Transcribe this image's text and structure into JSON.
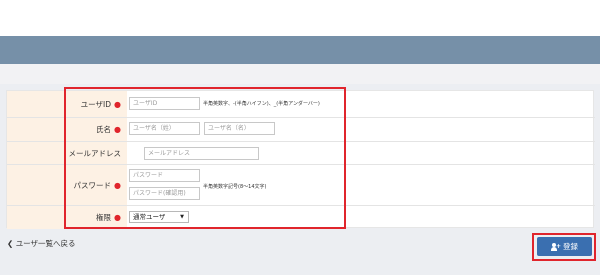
{
  "form": {
    "rows": {
      "userid": {
        "label": "ユーザID",
        "required": "●",
        "placeholder": "ユーザID",
        "hint": "半角英数字、-(半角ハイフン)、_(半角アンダーバー)"
      },
      "name": {
        "label": "氏名",
        "required": "●",
        "last_placeholder": "ユーザ名（姓）",
        "first_placeholder": "ユーザ名（名）"
      },
      "email": {
        "label": "メールアドレス",
        "placeholder": "メールアドレス"
      },
      "password": {
        "label": "パスワード",
        "required": "●",
        "placeholder": "パスワード",
        "confirm_placeholder": "パスワード(確認用)",
        "hint": "半角英数字記号(8〜14文字)"
      },
      "role": {
        "label": "権限",
        "required": "●",
        "selected": "通常ユーザ",
        "arrow": "▼"
      }
    }
  },
  "footer": {
    "back_chevron": "❮",
    "back_label": "ユーザ一覧へ戻る",
    "register_label": "登録"
  },
  "colors": {
    "header_band": "#7690a8",
    "label_bg": "#fdf1e4",
    "required_marker": "#e0252c",
    "highlight_box": "#e0252c",
    "register_button": "#3a6fb0"
  },
  "icons": {
    "register": "user-plus-icon",
    "back": "chevron-left-icon"
  }
}
